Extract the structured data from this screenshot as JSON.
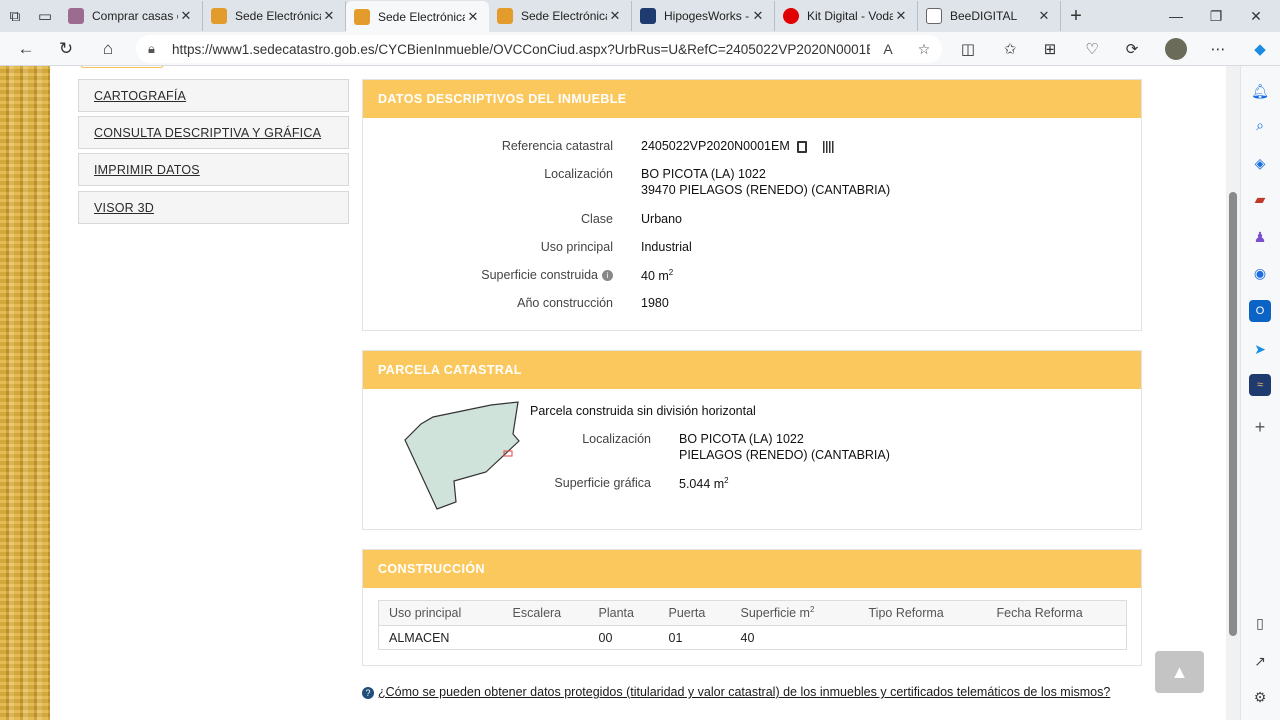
{
  "browser": {
    "tabs": [
      {
        "title": "Comprar casas en",
        "favicon_color": "#9b6c8f"
      },
      {
        "title": "Sede Electrónica",
        "favicon_color": "#e39c2b"
      },
      {
        "title": "Sede Electrónica",
        "favicon_color": "#e39c2b"
      },
      {
        "title": "Sede Electrónica",
        "favicon_color": "#e39c2b"
      },
      {
        "title": "HipogesWorks -",
        "favicon_color": "#1f3a6e"
      },
      {
        "title": "Kit Digital - Voda",
        "favicon_color": "#e00000"
      },
      {
        "title": "BeeDIGITAL",
        "favicon_color": "#888888"
      }
    ],
    "active_tab": 2,
    "url": "https://www1.sedecatastro.gob.es/CYCBienInmueble/OVCConCiud.aspx?UrbRus=U&RefC=2405022VP2020N0001E..."
  },
  "sidebar_menu": {
    "items": [
      "CARTOGRAFÍA",
      "CONSULTA DESCRIPTIVA Y GRÁFICA",
      "IMPRIMIR DATOS",
      "VISOR 3D"
    ]
  },
  "datos": {
    "header": "DATOS DESCRIPTIVOS DEL INMUEBLE",
    "ref_label": "Referencia catastral",
    "ref_value": "2405022VP2020N0001EM",
    "loc_label": "Localización",
    "loc_line1": "BO PICOTA (LA) 1022",
    "loc_line2": "39470 PIELAGOS (RENEDO) (CANTABRIA)",
    "clase_label": "Clase",
    "clase_value": "Urbano",
    "uso_label": "Uso principal",
    "uso_value": "Industrial",
    "sup_label": "Superficie construida",
    "sup_value": "40 m",
    "sup_sup": "2",
    "anio_label": "Año construcción",
    "anio_value": "1980"
  },
  "parcela": {
    "header": "PARCELA CATASTRAL",
    "subtitle": "Parcela construida sin división horizontal",
    "loc_label": "Localización",
    "loc_line1": "BO PICOTA (LA) 1022",
    "loc_line2": "PIELAGOS (RENEDO) (CANTABRIA)",
    "sup_label": "Superficie gráfica",
    "sup_value": "5.044 m",
    "sup_sup": "2"
  },
  "construccion": {
    "header": "CONSTRUCCIÓN",
    "columns": [
      "Uso principal",
      "Escalera",
      "Planta",
      "Puerta",
      "Superficie m",
      "Tipo Reforma",
      "Fecha Reforma"
    ],
    "sup_col_sup": "2",
    "rows": [
      [
        "ALMACEN",
        "",
        "00",
        "01",
        "40",
        "",
        ""
      ]
    ]
  },
  "footer": {
    "question": "¿Cómo se pueden obtener datos protegidos (titularidad y valor catastral) de los inmuebles y certificados telemáticos de los mismos?"
  },
  "colors": {
    "accent": "#fbc85e",
    "parcel_fill": "#cfe3da"
  },
  "icons": {
    "back": "back-arrow-icon",
    "reload": "reload-icon",
    "home": "home-icon",
    "lock": "lock-icon",
    "copy": "copy-icon",
    "barcode": "barcode-icon",
    "info": "info-icon",
    "scroll_top": "chevron-up-icon"
  }
}
